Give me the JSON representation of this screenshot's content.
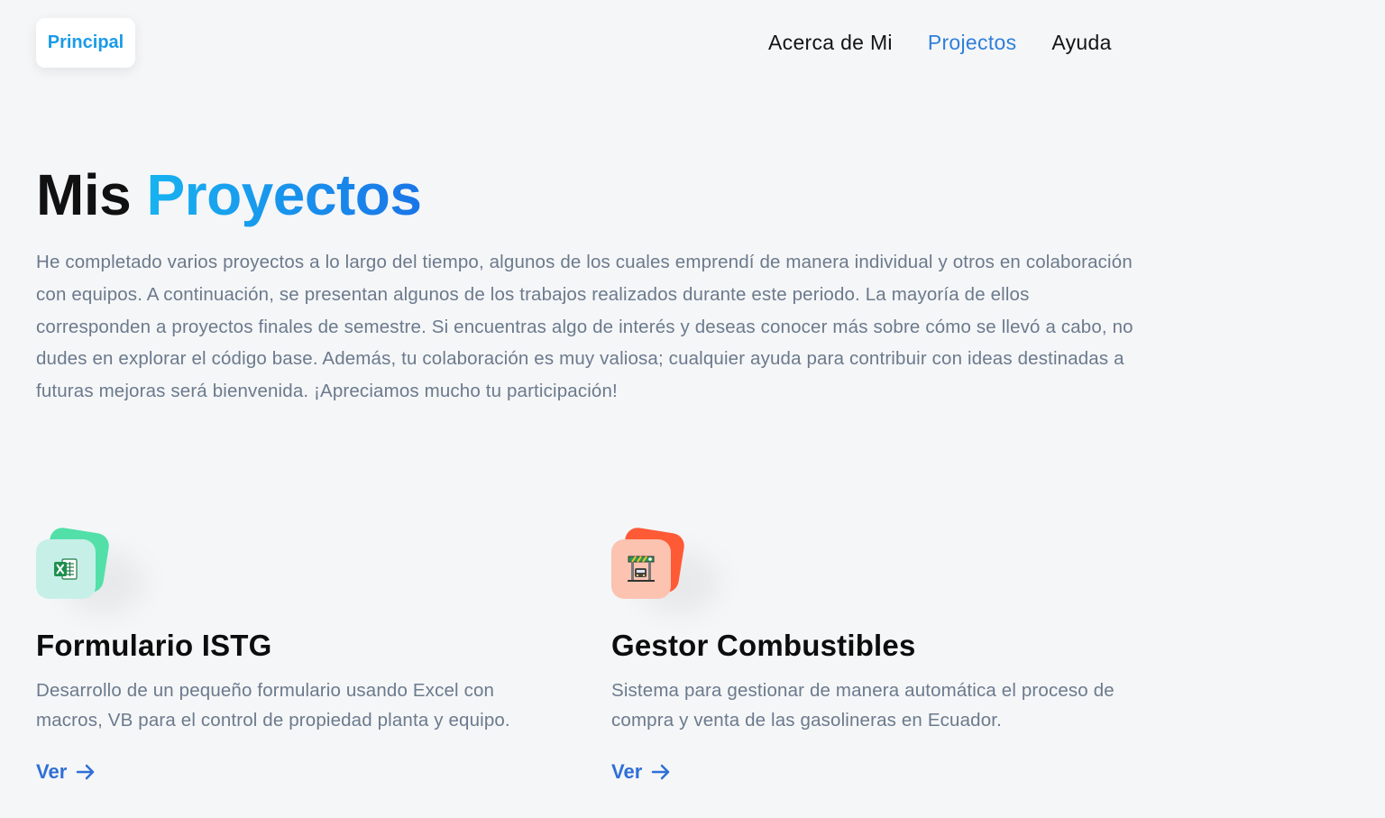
{
  "header": {
    "logo_label": "Principal",
    "nav": [
      {
        "label": "Acerca de Mi"
      },
      {
        "label": "Projectos"
      },
      {
        "label": "Ayuda"
      }
    ]
  },
  "hero": {
    "title_plain": "Mis",
    "title_accent": "Proyectos",
    "intro": "He completado varios proyectos a lo largo del tiempo, algunos de los cuales emprendí de manera individual y otros en colaboración con equipos. A continuación, se presentan algunos de los trabajos realizados durante este periodo. La mayoría de ellos corresponden a proyectos finales de semestre. Si encuentras algo de interés y deseas conocer más sobre cómo se llevó a cabo, no dudes en explorar el código base. Además, tu colaboración es muy valiosa; cualquier ayuda para contribuir con ideas destinadas a futuras mejoras será bienvenida. ¡Apreciamos mucho tu participación!"
  },
  "projects": [
    {
      "icon": "excel-icon",
      "title": "Formulario ISTG",
      "description": "Desarrollo de un pequeño formulario usando Excel con macros, VB para el control de propiedad planta y equipo.",
      "link_label": "Ver"
    },
    {
      "icon": "gas-station-icon",
      "title": "Gestor Combustibles",
      "description": "Sistema para gestionar de manera automática el proceso de compra y venta de las gasolineras en Ecuador.",
      "link_label": "Ver"
    }
  ],
  "colors": {
    "background": "#f5f6f8",
    "accent_blue": "#2f7fd9",
    "title_gradient_start": "#17b3f0",
    "title_gradient_end": "#1a75e8",
    "body_text": "#6b7a8c",
    "excel_card_back": "#52e0a8",
    "fuel_card_back": "#ff5a36"
  }
}
